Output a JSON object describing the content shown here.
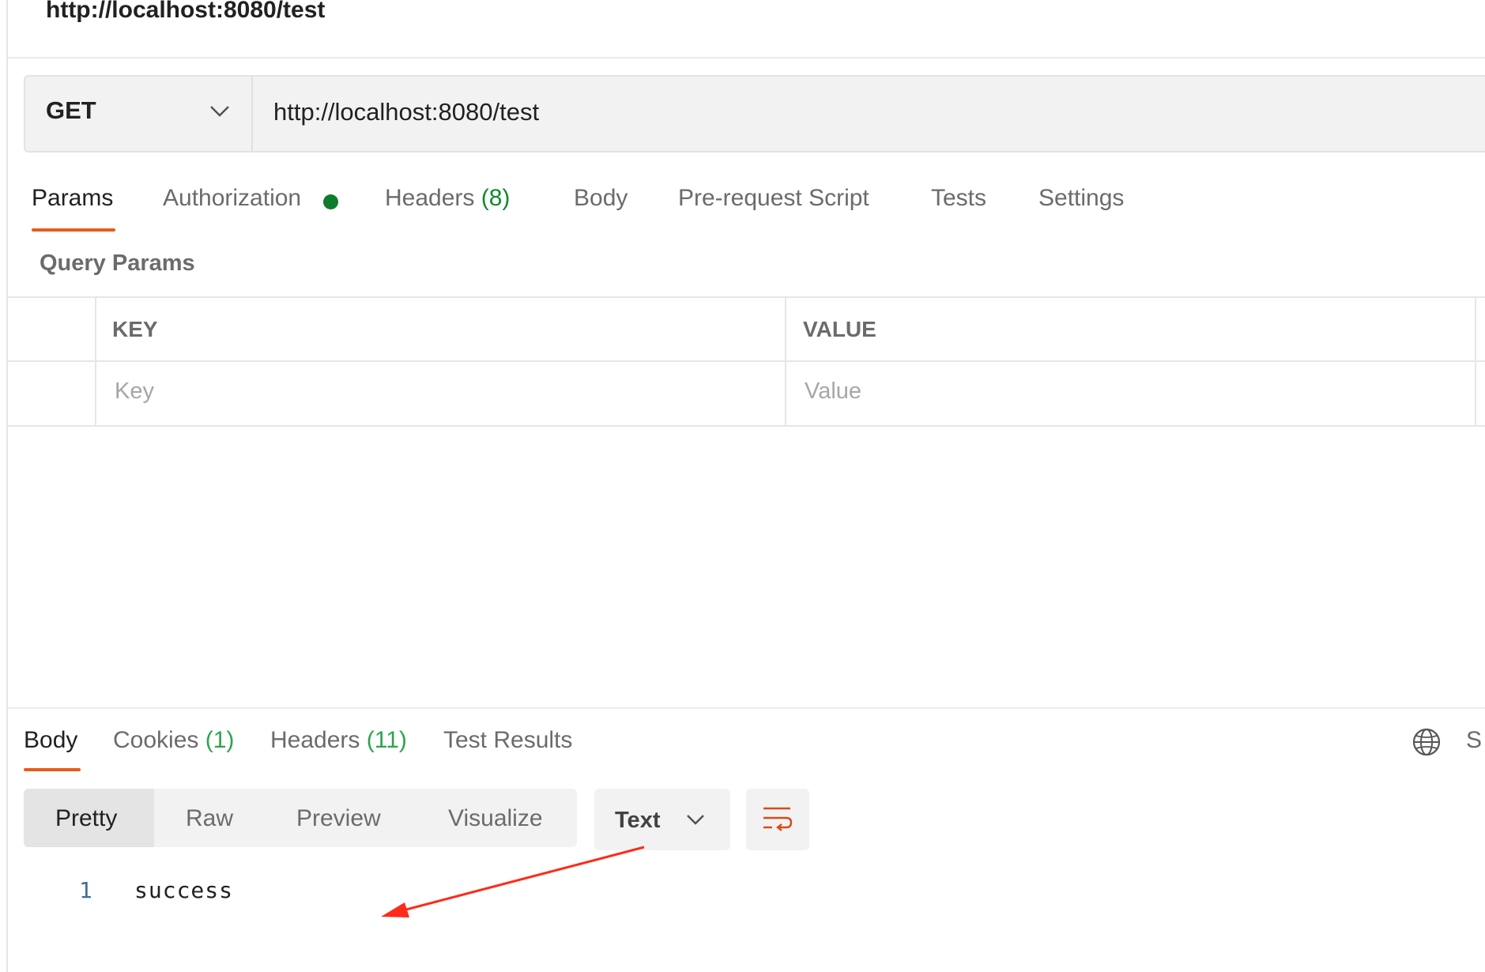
{
  "request": {
    "title": "http://localhost:8080/test",
    "method": "GET",
    "url": "http://localhost:8080/test"
  },
  "request_tabs": {
    "params": "Params",
    "authorization": "Authorization",
    "headers": "Headers",
    "headers_count": "(8)",
    "body": "Body",
    "pre_request_script": "Pre-request Script",
    "tests": "Tests",
    "settings": "Settings"
  },
  "query_params": {
    "label": "Query Params",
    "columns": {
      "key": "KEY",
      "value": "VALUE"
    },
    "placeholders": {
      "key": "Key",
      "value": "Value"
    }
  },
  "response_tabs": {
    "body": "Body",
    "cookies": "Cookies",
    "cookies_count": "(1)",
    "headers": "Headers",
    "headers_count": "(11)",
    "test_results": "Test Results",
    "truncated_right": "S"
  },
  "response_view": {
    "modes": [
      "Pretty",
      "Raw",
      "Preview",
      "Visualize"
    ],
    "format": "Text",
    "lines": [
      {
        "number": "1",
        "text": "success"
      }
    ]
  },
  "colors": {
    "accent": "#e85a1c",
    "auth_dot": "#0f7b2c",
    "annotation_arrow": "#ff2a1a"
  },
  "icons": {
    "method_dropdown": "chevron-down-icon",
    "format_dropdown": "chevron-down-icon",
    "word_wrap": "wrap-lines-icon",
    "network": "globe-icon"
  }
}
